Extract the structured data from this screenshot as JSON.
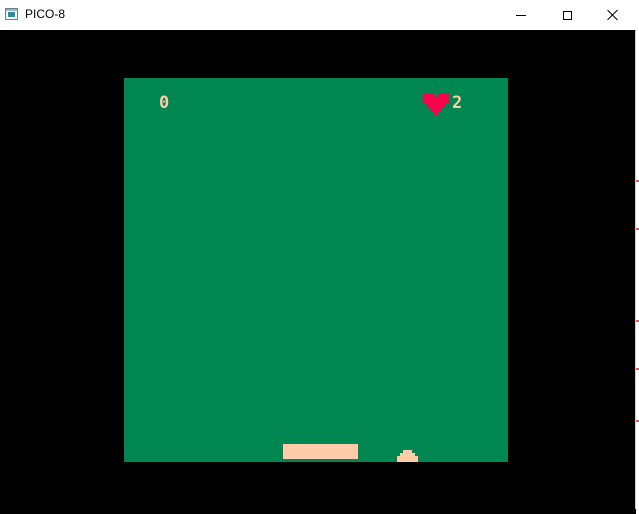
{
  "window": {
    "title": "PICO-8",
    "icon": "pico8-app-icon",
    "controls": {
      "minimize": "minimize-icon",
      "maximize": "maximize-icon",
      "close": "close-icon"
    }
  },
  "game": {
    "score": "0",
    "lives": "2",
    "lives_icon": "heart-icon",
    "colors": {
      "background": "#008751",
      "border": "#000000",
      "text": "#ffccaa",
      "heart": "#ff004d",
      "paddle": "#ffccaa",
      "ball": "#ffccaa"
    }
  }
}
